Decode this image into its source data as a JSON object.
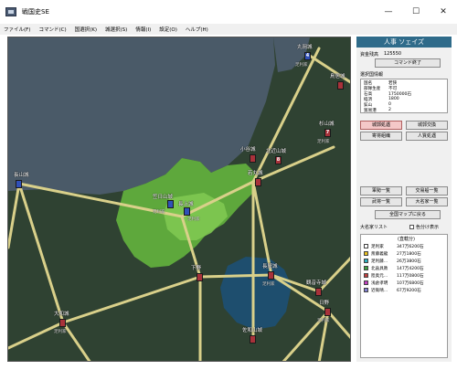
{
  "window": {
    "title": "戦国史SE",
    "minimize": "—",
    "maximize": "☐",
    "close": "✕"
  },
  "menu": [
    "ファイル(F)",
    "コマンド(C)",
    "国選択(K)",
    "城選択(S)",
    "情報(I)",
    "設定(O)",
    "ヘルプ(H)"
  ],
  "map": {
    "castles": [
      {
        "label": "丸岡城",
        "sub": "足利家",
        "color": "blue",
        "num": "4"
      },
      {
        "label": "鳥居城",
        "sub": "",
        "color": "red",
        "num": ""
      },
      {
        "label": "杉山城",
        "sub": "足利家",
        "color": "red",
        "num": "7"
      },
      {
        "label": "小谷城",
        "sub": "三好家",
        "color": "red",
        "num": ""
      },
      {
        "label": "北近山城",
        "sub": "",
        "color": "red",
        "num": ""
      },
      {
        "label": "若丸城",
        "sub": "",
        "color": "red",
        "num": ""
      },
      {
        "label": "笠日山城",
        "sub": "足利家",
        "color": "blue",
        "num": ""
      },
      {
        "label": "長上城",
        "sub": "足利家",
        "color": "blue",
        "num": ""
      },
      {
        "label": "長山城",
        "sub": "",
        "color": "blue",
        "num": ""
      },
      {
        "label": "下野",
        "sub": "",
        "color": "red",
        "num": ""
      },
      {
        "label": "日野",
        "sub": "足利家",
        "color": "red",
        "num": ""
      },
      {
        "label": "長屋城",
        "sub": "足利家",
        "color": "red",
        "num": ""
      },
      {
        "label": "観音寺城",
        "sub": "足利家",
        "color": "red",
        "num": ""
      },
      {
        "label": "大和城",
        "sub": "足利家",
        "color": "red",
        "num": ""
      },
      {
        "label": "佐和山城",
        "sub": "",
        "color": "red",
        "num": ""
      },
      {
        "label": "",
        "sub": "",
        "color": "red",
        "num": "8"
      }
    ]
  },
  "panel": {
    "header": "人事 ソェイズ",
    "funds_label": "資金残高",
    "funds_value": "125550",
    "command_end": "コマンド終了",
    "selected_info_label": "選択国情報",
    "info": [
      {
        "k": "国名",
        "v": "若狭"
      },
      {
        "k": "部隊生産",
        "v": "不可"
      },
      {
        "k": "石高",
        "v": "1750000石"
      },
      {
        "k": "経済",
        "v": "1800"
      },
      {
        "k": "鉱山",
        "v": "0"
      },
      {
        "k": "貿易港",
        "v": "2"
      }
    ],
    "btn_castle_handle": "城郭処遇",
    "btn_castle_exchange": "城郭交換",
    "btn_retainer": "寄将組織",
    "btn_personnel": "人質処遇",
    "btn_army_list": "軍勢一覧",
    "btn_trade_list": "交易船一覧",
    "btn_general_list": "武将一覧",
    "btn_daimyo_list": "大名家一覧",
    "btn_map_back": "全国マップに戻る",
    "list_label": "大名家リスト",
    "color_split": "色分け表示",
    "list_header": "(直轄分)",
    "daimyo": [
      {
        "name": "足利家",
        "value": "347万6200石",
        "color": "#ffffff"
      },
      {
        "name": "斎藤義龍",
        "value": "27万1800石",
        "color": "#e8c020"
      },
      {
        "name": "足利藤...",
        "value": "26万3800石",
        "color": "#30b0c0"
      },
      {
        "name": "北畠具教",
        "value": "147万4200石",
        "color": "#40a040"
      },
      {
        "name": "陸奥元...",
        "value": "117万0800石",
        "color": "#c04040"
      },
      {
        "name": "浅倉孝明",
        "value": "107万6800石",
        "color": "#c040c0"
      },
      {
        "name": "近衛晴...",
        "value": "67万9200石",
        "color": "#8080d0"
      }
    ]
  }
}
